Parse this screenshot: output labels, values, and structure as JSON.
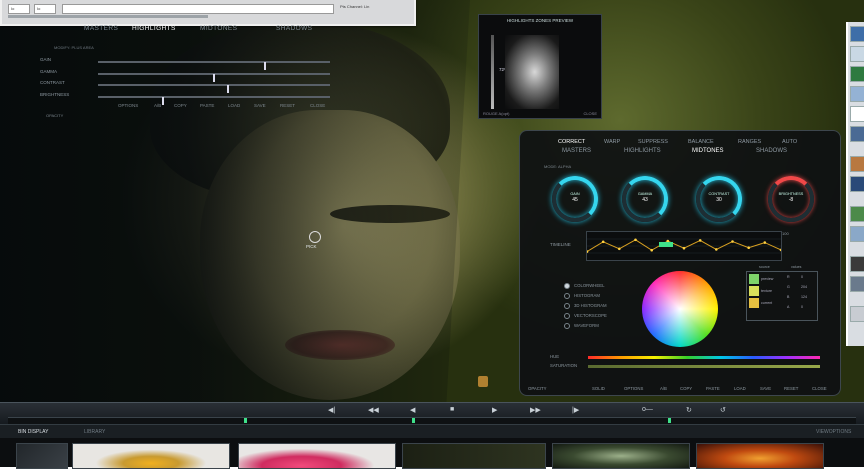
{
  "top_window": {
    "field1": "Io",
    "field2": "Io",
    "right_label": "Pts Channel: Lin"
  },
  "left_panel": {
    "tabs": [
      {
        "label": "MASTERS",
        "active": false
      },
      {
        "label": "HIGHLIGHTS",
        "active": true
      },
      {
        "label": "MIDTONES",
        "active": false
      },
      {
        "label": "SHADOWS",
        "active": false
      }
    ],
    "section_label": "MODIFY: PLUS AREA",
    "sliders": [
      {
        "label": "GAIN",
        "value": 0.72
      },
      {
        "label": "GAMMA",
        "value": 0.5
      },
      {
        "label": "CONTRAST",
        "value": 0.56
      },
      {
        "label": "BRIGHTNESS",
        "value": 0.28
      }
    ],
    "buttons": [
      "OPTIONS",
      "A/B",
      "COPY",
      "PASTE",
      "LOAD",
      "SAVE",
      "RESET",
      "CLOSE"
    ],
    "opacity_label": "OPACITY"
  },
  "preview": {
    "title": "HIGHLIGHTS ZONES PREVIEW",
    "percent": "72%",
    "footer": "ROUGE A(opt)",
    "close": "CLOSE"
  },
  "pick_label": "PICK",
  "right_panel": {
    "top_tabs": [
      {
        "label": "CORRECT",
        "active": true
      },
      {
        "label": "WARP",
        "active": false
      },
      {
        "label": "SUPPRESS",
        "active": false
      },
      {
        "label": "BALANCE",
        "active": false
      },
      {
        "label": "RANGES",
        "active": false
      },
      {
        "label": "AUTO",
        "active": false
      }
    ],
    "sub_tabs": [
      {
        "label": "MASTERS",
        "active": false
      },
      {
        "label": "HIGHLIGHTS",
        "active": false
      },
      {
        "label": "MIDTONES",
        "active": true
      },
      {
        "label": "SHADOWS",
        "active": false
      }
    ],
    "mode_label": "MODE: ALPHA",
    "dials": [
      {
        "label": "GAIN",
        "value": "45",
        "color": "#35d6ef"
      },
      {
        "label": "GAMMA",
        "value": "43",
        "color": "#35d6ef"
      },
      {
        "label": "CONTRAST",
        "value": "30",
        "color": "#35d6ef"
      },
      {
        "label": "BRIGHTNESS",
        "value": "-8",
        "color": "#f04848"
      }
    ],
    "timeline_label": "TIMELINE",
    "timeline_max": "100",
    "timeline_points": [
      30,
      65,
      40,
      72,
      35,
      68,
      42,
      70,
      38,
      66,
      44,
      62,
      36
    ],
    "display_options": [
      {
        "label": "COLORWHEEL",
        "selected": true
      },
      {
        "label": "HISTOGRAM",
        "selected": false
      },
      {
        "label": "3D HISTOGRAM",
        "selected": false
      },
      {
        "label": "VECTORSCOPE",
        "selected": false
      },
      {
        "label": "WAVEFORM",
        "selected": false
      }
    ],
    "swatch_headers": [
      "source",
      "values"
    ],
    "swatches": [
      {
        "label": "preview",
        "color": "#7ed36a",
        "channel": "R",
        "value": "0"
      },
      {
        "label": "texture",
        "color": "#d9e05a",
        "channel": "G",
        "value": "204"
      },
      {
        "label": "current",
        "color": "#e6c040",
        "channel": "B",
        "value": "124"
      }
    ],
    "swatch_extra": {
      "channel": "A",
      "value": "0"
    },
    "hue_label": "HUE",
    "saturation_label": "SATURATION",
    "footer": [
      "OPACITY",
      "SOLID",
      "OPTIONS",
      "A/B",
      "COPY",
      "PASTE",
      "LOAD",
      "SAVE",
      "RESET",
      "CLOSE"
    ]
  },
  "transport": {
    "buttons": [
      "skip-start-icon",
      "rewind-icon",
      "step-back-icon",
      "stop-icon",
      "play-icon",
      "step-forward-icon",
      "skip-end-icon",
      "key-icon",
      "loop-icon",
      "undo-icon"
    ],
    "glyphs": [
      "◀|",
      "◀◀",
      "◀",
      "■",
      "▶",
      "▶▶",
      "|▶",
      "o—",
      "↻",
      "↺"
    ]
  },
  "bin": {
    "title": "BIN DISPLAY",
    "library": "LIBRARY",
    "right_label": "VIEWOPTIONS"
  }
}
